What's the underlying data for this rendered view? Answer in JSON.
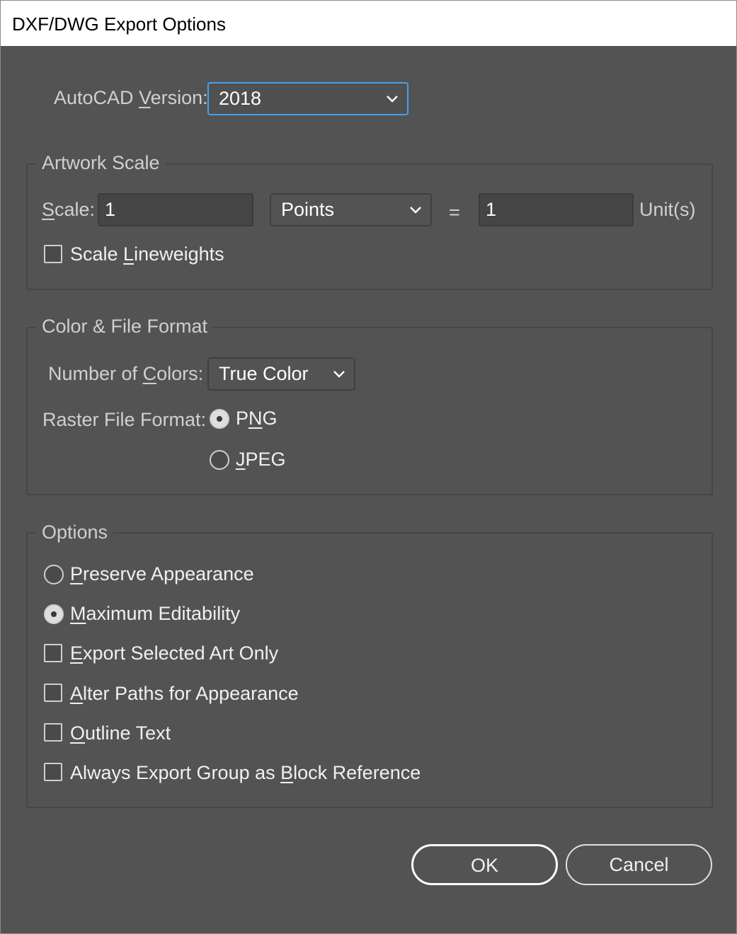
{
  "window": {
    "title": "DXF/DWG Export Options"
  },
  "autocad": {
    "label_pre": "AutoCAD ",
    "label_u": "V",
    "label_post": "ersion:",
    "value": "2018"
  },
  "artwork_scale": {
    "legend": "Artwork Scale",
    "scale_label_u": "S",
    "scale_label_post": "cale:",
    "scale_value": "1",
    "unit_value": "Points",
    "equals": "=",
    "target_value": "1",
    "target_units": "Unit(s)",
    "lineweights_pre": "Scale ",
    "lineweights_u": "L",
    "lineweights_post": "ineweights",
    "lineweights_checked": false
  },
  "color_format": {
    "legend": "Color & File Format",
    "colors_label_pre": "Number of ",
    "colors_label_u": "C",
    "colors_label_post": "olors:",
    "colors_value": "True Color",
    "raster_label": "Raster File Format:",
    "png_pre": "P",
    "png_u": "N",
    "png_post": "G",
    "jpeg_u": "J",
    "jpeg_post": "PEG",
    "selected": "PNG"
  },
  "options": {
    "legend": "Options",
    "preserve_u": "P",
    "preserve_post": "reserve Appearance",
    "editability_u": "M",
    "editability_post": "aximum Editability",
    "selected_art_u": "E",
    "selected_art_post": "xport Selected Art Only",
    "alter_paths_u": "A",
    "alter_paths_post": "lter Paths for Appearance",
    "outline_u": "O",
    "outline_post": "utline Text",
    "block_pre": "Always Export Group as ",
    "block_u": "B",
    "block_post": "lock Reference",
    "mode_selected": "Maximum Editability"
  },
  "buttons": {
    "ok": "OK",
    "cancel": "Cancel"
  },
  "colors": {
    "focus": "#46a0f0",
    "background": "#535353"
  }
}
